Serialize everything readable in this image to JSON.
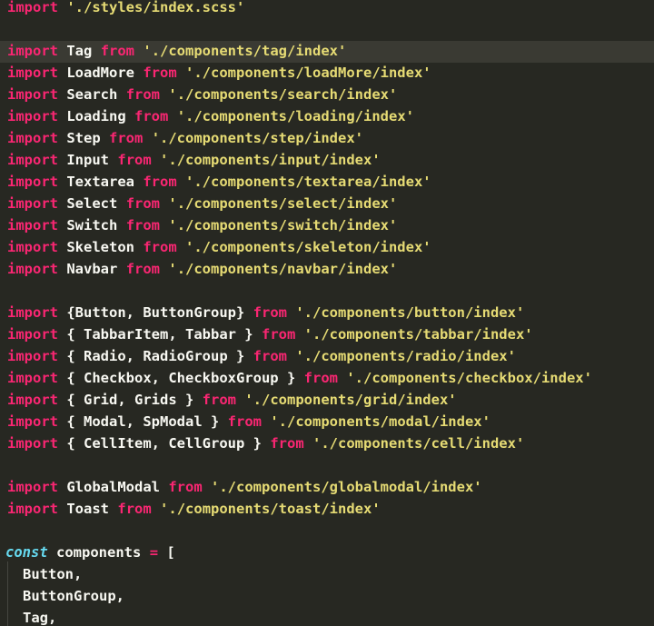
{
  "editor": {
    "lines": [
      {
        "kind": "import",
        "kw": "import",
        "names": "",
        "from": "",
        "path": "'./styles/index.scss'"
      },
      {
        "kind": "blank"
      },
      {
        "kind": "import",
        "kw": "import",
        "names": "Tag",
        "from": "from",
        "path": "'./components/tag/index'",
        "highlight": true
      },
      {
        "kind": "import",
        "kw": "import",
        "names": "LoadMore",
        "from": "from",
        "path": "'./components/loadMore/index'"
      },
      {
        "kind": "import",
        "kw": "import",
        "names": "Search",
        "from": "from",
        "path": "'./components/search/index'"
      },
      {
        "kind": "import",
        "kw": "import",
        "names": "Loading",
        "from": "from",
        "path": "'./components/loading/index'"
      },
      {
        "kind": "import",
        "kw": "import",
        "names": "Step",
        "from": "from",
        "path": "'./components/step/index'"
      },
      {
        "kind": "import",
        "kw": "import",
        "names": "Input",
        "from": "from",
        "path": "'./components/input/index'"
      },
      {
        "kind": "import",
        "kw": "import",
        "names": "Textarea",
        "from": "from",
        "path": "'./components/textarea/index'"
      },
      {
        "kind": "import",
        "kw": "import",
        "names": "Select",
        "from": "from",
        "path": "'./components/select/index'"
      },
      {
        "kind": "import",
        "kw": "import",
        "names": "Switch",
        "from": "from",
        "path": "'./components/switch/index'"
      },
      {
        "kind": "import",
        "kw": "import",
        "names": "Skeleton",
        "from": "from",
        "path": "'./components/skeleton/index'"
      },
      {
        "kind": "import",
        "kw": "import",
        "names": "Navbar",
        "from": "from",
        "path": "'./components/navbar/index'"
      },
      {
        "kind": "blank"
      },
      {
        "kind": "import",
        "kw": "import",
        "names": "{Button, ButtonGroup}",
        "from": "from",
        "path": "'./components/button/index'"
      },
      {
        "kind": "import",
        "kw": "import",
        "names": "{ TabbarItem, Tabbar }",
        "from": "from",
        "path": "'./components/tabbar/index'"
      },
      {
        "kind": "import",
        "kw": "import",
        "names": "{ Radio, RadioGroup }",
        "from": "from",
        "path": "'./components/radio/index'"
      },
      {
        "kind": "import",
        "kw": "import",
        "names": "{ Checkbox, CheckboxGroup }",
        "from": "from",
        "path": "'./components/checkbox/index'"
      },
      {
        "kind": "import",
        "kw": "import",
        "names": "{ Grid, Grids }",
        "from": "from",
        "path": "'./components/grid/index'"
      },
      {
        "kind": "import",
        "kw": "import",
        "names": "{ Modal, SpModal }",
        "from": "from",
        "path": "'./components/modal/index'"
      },
      {
        "kind": "import",
        "kw": "import",
        "names": "{ CellItem, CellGroup }",
        "from": "from",
        "path": "'./components/cell/index'"
      },
      {
        "kind": "blank"
      },
      {
        "kind": "import",
        "kw": "import",
        "names": "GlobalModal",
        "from": "from",
        "path": "'./components/globalmodal/index'"
      },
      {
        "kind": "import",
        "kw": "import",
        "names": "Toast",
        "from": "from",
        "path": "'./components/toast/index'"
      },
      {
        "kind": "blank"
      },
      {
        "kind": "decl",
        "kw": "const",
        "name": "components",
        "op": "=",
        "punc": "["
      },
      {
        "kind": "item",
        "text": "Button,"
      },
      {
        "kind": "item",
        "text": "ButtonGroup,"
      },
      {
        "kind": "item",
        "text": "Tag,"
      }
    ]
  },
  "colors": {
    "background": "#272822",
    "keyword": "#F92672",
    "string": "#E6DB74",
    "identifier": "#F8F8F2",
    "storage": "#66D9EF",
    "highlight": "#3A3A33"
  }
}
